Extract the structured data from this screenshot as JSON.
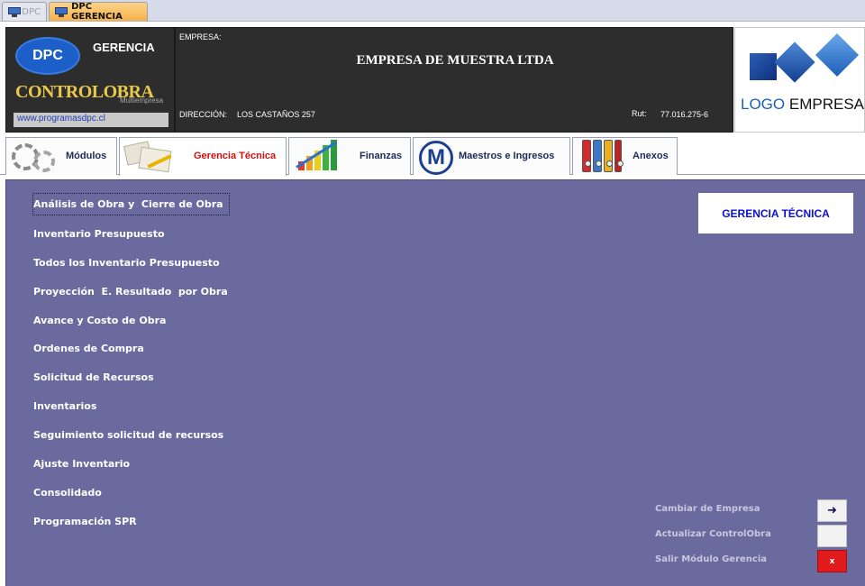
{
  "window_tabs": [
    {
      "label": "DPC",
      "active": false
    },
    {
      "label": "DPC GERENCIA",
      "active": true
    }
  ],
  "header": {
    "brand_logo": "DPC",
    "brand_title": "GERENCIA",
    "product_name": "CONTROLOBRA",
    "product_edition": "Multiempresa",
    "website": "www.programasdpc.cl",
    "empresa_label": "EMPRESA:",
    "empresa_name": "EMPRESA DE MUESTRA LTDA",
    "direccion_label": "DIRECCIÓN:",
    "direccion_value": "LOS CASTAÑOS 257",
    "rut_label": "Rut:",
    "rut_value": "77.016.275-6",
    "company_logo_text_1": "LOGO",
    "company_logo_text_2": "EMPRESA"
  },
  "tabs": [
    {
      "label": "Módulos",
      "icon": "gears-icon",
      "active": false
    },
    {
      "label": "Gerencia Técnica",
      "icon": "documents-icon",
      "active": true
    },
    {
      "label": "Finanzas",
      "icon": "bar-chart-icon",
      "active": false
    },
    {
      "label": "Maestros e Ingresos",
      "icon": "m-circle-icon",
      "active": false
    },
    {
      "label": "Anexos",
      "icon": "binders-icon",
      "active": false
    }
  ],
  "main": {
    "section_badge": "GERENCIA TÉCNICA",
    "menu_items": [
      "Análisis de Obra y  Cierre de Obra",
      "Inventario Presupuesto",
      "Todos los Inventario Presupuesto",
      "Proyección  E. Resultado  por Obra",
      "Avance y Costo de Obra",
      "Ordenes de Compra",
      "Solicitud de Recursos",
      "Inventarios",
      "Seguimiento solicitud de recursos",
      "Ajuste Inventario",
      "Consolidado",
      "Programación SPR"
    ],
    "actions": [
      {
        "label": "Cambiar de Empresa",
        "button_text": "➜",
        "icon": "arrow-right-icon"
      },
      {
        "label": "Actualizar ControlObra",
        "button_text": "",
        "icon": ""
      },
      {
        "label": "Salir Módulo Gerencia",
        "button_text": "x",
        "icon": "close-icon"
      }
    ]
  },
  "colors": {
    "panel_bg": "#6b6a9e",
    "active_tab_text": "#d01010",
    "badge_text": "#0b10d0",
    "exit_button": "#e11b1b"
  }
}
